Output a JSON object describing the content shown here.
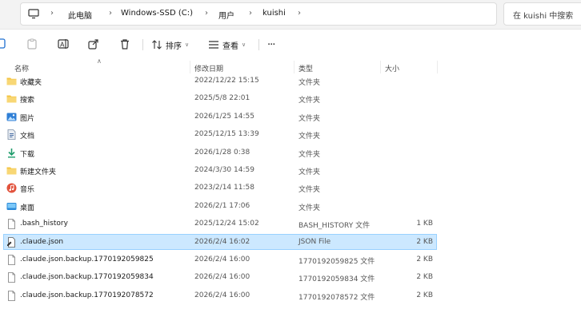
{
  "address": {
    "segments": [
      "此电脑",
      "Windows-SSD (C:)",
      "用户",
      "kuishi"
    ],
    "search_placeholder": "在 kuishi 中搜索"
  },
  "toolbar": {
    "sort_label": "排序",
    "view_label": "查看",
    "more_label": "···"
  },
  "columns": {
    "name": "名称",
    "date": "修改日期",
    "type": "类型",
    "size": "大小"
  },
  "colors": {
    "folder": "#f4c443",
    "selection": "#cce8ff",
    "selection_border": "#99d1ff"
  },
  "rows": [
    {
      "name": "收藏夹",
      "date": "2022/12/22 15:15",
      "type": "文件夹",
      "size": "",
      "icon": "favorites-folder-icon"
    },
    {
      "name": "搜索",
      "date": "2025/5/8 22:01",
      "type": "文件夹",
      "size": "",
      "icon": "searches-folder-icon"
    },
    {
      "name": "图片",
      "date": "2026/1/25 14:55",
      "type": "文件夹",
      "size": "",
      "icon": "pictures-folder-icon"
    },
    {
      "name": "文档",
      "date": "2025/12/15 13:39",
      "type": "文件夹",
      "size": "",
      "icon": "documents-folder-icon"
    },
    {
      "name": "下载",
      "date": "2026/1/28 0:38",
      "type": "文件夹",
      "size": "",
      "icon": "downloads-folder-icon"
    },
    {
      "name": "新建文件夹",
      "date": "2024/3/30 14:59",
      "type": "文件夹",
      "size": "",
      "icon": "folder-icon"
    },
    {
      "name": "音乐",
      "date": "2023/2/14 11:58",
      "type": "文件夹",
      "size": "",
      "icon": "music-folder-icon"
    },
    {
      "name": "桌面",
      "date": "2026/2/1 17:06",
      "type": "文件夹",
      "size": "",
      "icon": "desktop-folder-icon"
    },
    {
      "name": ".bash_history",
      "date": "2025/12/24 15:02",
      "type": "BASH_HISTORY 文件",
      "size": "1 KB",
      "icon": "file-icon"
    },
    {
      "name": ".claude.json",
      "date": "2026/2/4 16:02",
      "type": "JSON File",
      "size": "2 KB",
      "icon": "json-file-icon"
    },
    {
      "name": ".claude.json.backup.1770192059825",
      "date": "2026/2/4 16:00",
      "type": "1770192059825 文件",
      "size": "2 KB",
      "icon": "file-icon"
    },
    {
      "name": ".claude.json.backup.1770192059834",
      "date": "2026/2/4 16:00",
      "type": "1770192059834 文件",
      "size": "2 KB",
      "icon": "file-icon"
    },
    {
      "name": ".claude.json.backup.1770192078572",
      "date": "2026/2/4 16:00",
      "type": "1770192078572 文件",
      "size": "2 KB",
      "icon": "file-icon"
    }
  ],
  "selected_row": 9
}
